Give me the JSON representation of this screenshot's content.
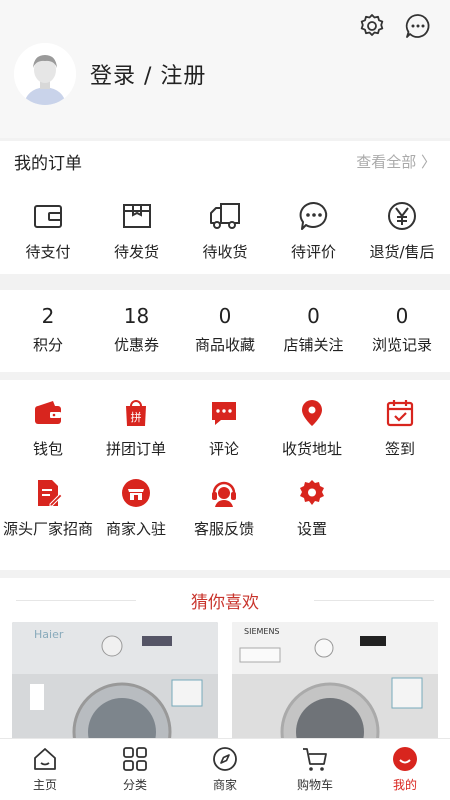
{
  "header": {
    "login_text": "登录 / 注册"
  },
  "orders": {
    "title": "我的订单",
    "view_all": "查看全部 〉",
    "items": [
      {
        "label": "待支付",
        "icon": "wallet-icon"
      },
      {
        "label": "待发货",
        "icon": "package-icon"
      },
      {
        "label": "待收货",
        "icon": "truck-icon"
      },
      {
        "label": "待评价",
        "icon": "chat-icon"
      },
      {
        "label": "退货/售后",
        "icon": "yen-icon"
      }
    ]
  },
  "stats": [
    {
      "value": "2",
      "label": "积分"
    },
    {
      "value": "18",
      "label": "优惠券"
    },
    {
      "value": "0",
      "label": "商品收藏"
    },
    {
      "value": "0",
      "label": "店铺关注"
    },
    {
      "value": "0",
      "label": "浏览记录"
    }
  ],
  "tools": [
    {
      "label": "钱包",
      "icon": "wallet-icon"
    },
    {
      "label": "拼团订单",
      "icon": "group-bag-icon"
    },
    {
      "label": "评论",
      "icon": "comment-icon"
    },
    {
      "label": "收货地址",
      "icon": "location-icon"
    },
    {
      "label": "签到",
      "icon": "calendar-icon"
    },
    {
      "label": "源头厂家招商",
      "icon": "document-edit-icon"
    },
    {
      "label": "商家入驻",
      "icon": "store-icon"
    },
    {
      "label": "客服反馈",
      "icon": "headset-icon"
    },
    {
      "label": "设置",
      "icon": "gear-icon"
    }
  ],
  "guess": {
    "title": "猜你喜欢",
    "products": [
      {
        "brand": "Haier"
      },
      {
        "brand": "SIEMENS"
      }
    ]
  },
  "tabbar": [
    {
      "label": "主页",
      "icon": "home-icon"
    },
    {
      "label": "分类",
      "icon": "grid-icon"
    },
    {
      "label": "商家",
      "icon": "compass-icon"
    },
    {
      "label": "购物车",
      "icon": "cart-icon"
    },
    {
      "label": "我的",
      "icon": "profile-icon",
      "active": true
    }
  ],
  "colors": {
    "accent": "#d8251e",
    "guess_title": "#c8342c"
  }
}
